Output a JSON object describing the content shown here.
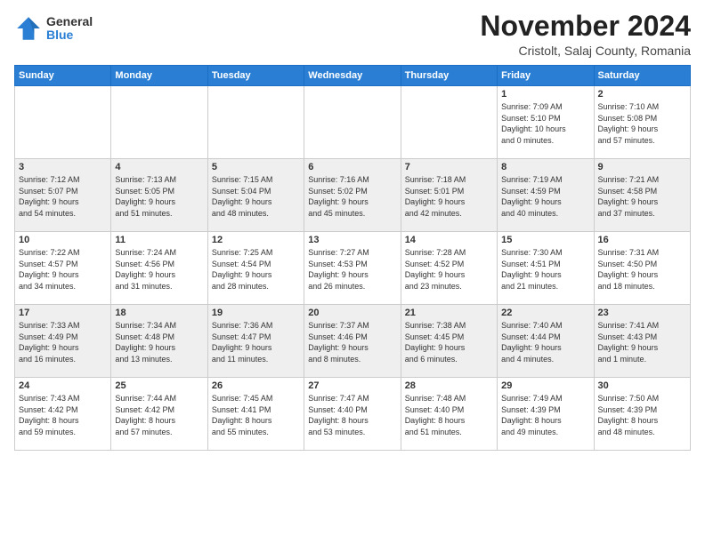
{
  "logo": {
    "general": "General",
    "blue": "Blue"
  },
  "title": "November 2024",
  "location": "Cristolt, Salaj County, Romania",
  "days_header": [
    "Sunday",
    "Monday",
    "Tuesday",
    "Wednesday",
    "Thursday",
    "Friday",
    "Saturday"
  ],
  "weeks": [
    [
      {
        "day": "",
        "info": ""
      },
      {
        "day": "",
        "info": ""
      },
      {
        "day": "",
        "info": ""
      },
      {
        "day": "",
        "info": ""
      },
      {
        "day": "",
        "info": ""
      },
      {
        "day": "1",
        "info": "Sunrise: 7:09 AM\nSunset: 5:10 PM\nDaylight: 10 hours\nand 0 minutes."
      },
      {
        "day": "2",
        "info": "Sunrise: 7:10 AM\nSunset: 5:08 PM\nDaylight: 9 hours\nand 57 minutes."
      }
    ],
    [
      {
        "day": "3",
        "info": "Sunrise: 7:12 AM\nSunset: 5:07 PM\nDaylight: 9 hours\nand 54 minutes."
      },
      {
        "day": "4",
        "info": "Sunrise: 7:13 AM\nSunset: 5:05 PM\nDaylight: 9 hours\nand 51 minutes."
      },
      {
        "day": "5",
        "info": "Sunrise: 7:15 AM\nSunset: 5:04 PM\nDaylight: 9 hours\nand 48 minutes."
      },
      {
        "day": "6",
        "info": "Sunrise: 7:16 AM\nSunset: 5:02 PM\nDaylight: 9 hours\nand 45 minutes."
      },
      {
        "day": "7",
        "info": "Sunrise: 7:18 AM\nSunset: 5:01 PM\nDaylight: 9 hours\nand 42 minutes."
      },
      {
        "day": "8",
        "info": "Sunrise: 7:19 AM\nSunset: 4:59 PM\nDaylight: 9 hours\nand 40 minutes."
      },
      {
        "day": "9",
        "info": "Sunrise: 7:21 AM\nSunset: 4:58 PM\nDaylight: 9 hours\nand 37 minutes."
      }
    ],
    [
      {
        "day": "10",
        "info": "Sunrise: 7:22 AM\nSunset: 4:57 PM\nDaylight: 9 hours\nand 34 minutes."
      },
      {
        "day": "11",
        "info": "Sunrise: 7:24 AM\nSunset: 4:56 PM\nDaylight: 9 hours\nand 31 minutes."
      },
      {
        "day": "12",
        "info": "Sunrise: 7:25 AM\nSunset: 4:54 PM\nDaylight: 9 hours\nand 28 minutes."
      },
      {
        "day": "13",
        "info": "Sunrise: 7:27 AM\nSunset: 4:53 PM\nDaylight: 9 hours\nand 26 minutes."
      },
      {
        "day": "14",
        "info": "Sunrise: 7:28 AM\nSunset: 4:52 PM\nDaylight: 9 hours\nand 23 minutes."
      },
      {
        "day": "15",
        "info": "Sunrise: 7:30 AM\nSunset: 4:51 PM\nDaylight: 9 hours\nand 21 minutes."
      },
      {
        "day": "16",
        "info": "Sunrise: 7:31 AM\nSunset: 4:50 PM\nDaylight: 9 hours\nand 18 minutes."
      }
    ],
    [
      {
        "day": "17",
        "info": "Sunrise: 7:33 AM\nSunset: 4:49 PM\nDaylight: 9 hours\nand 16 minutes."
      },
      {
        "day": "18",
        "info": "Sunrise: 7:34 AM\nSunset: 4:48 PM\nDaylight: 9 hours\nand 13 minutes."
      },
      {
        "day": "19",
        "info": "Sunrise: 7:36 AM\nSunset: 4:47 PM\nDaylight: 9 hours\nand 11 minutes."
      },
      {
        "day": "20",
        "info": "Sunrise: 7:37 AM\nSunset: 4:46 PM\nDaylight: 9 hours\nand 8 minutes."
      },
      {
        "day": "21",
        "info": "Sunrise: 7:38 AM\nSunset: 4:45 PM\nDaylight: 9 hours\nand 6 minutes."
      },
      {
        "day": "22",
        "info": "Sunrise: 7:40 AM\nSunset: 4:44 PM\nDaylight: 9 hours\nand 4 minutes."
      },
      {
        "day": "23",
        "info": "Sunrise: 7:41 AM\nSunset: 4:43 PM\nDaylight: 9 hours\nand 1 minute."
      }
    ],
    [
      {
        "day": "24",
        "info": "Sunrise: 7:43 AM\nSunset: 4:42 PM\nDaylight: 8 hours\nand 59 minutes."
      },
      {
        "day": "25",
        "info": "Sunrise: 7:44 AM\nSunset: 4:42 PM\nDaylight: 8 hours\nand 57 minutes."
      },
      {
        "day": "26",
        "info": "Sunrise: 7:45 AM\nSunset: 4:41 PM\nDaylight: 8 hours\nand 55 minutes."
      },
      {
        "day": "27",
        "info": "Sunrise: 7:47 AM\nSunset: 4:40 PM\nDaylight: 8 hours\nand 53 minutes."
      },
      {
        "day": "28",
        "info": "Sunrise: 7:48 AM\nSunset: 4:40 PM\nDaylight: 8 hours\nand 51 minutes."
      },
      {
        "day": "29",
        "info": "Sunrise: 7:49 AM\nSunset: 4:39 PM\nDaylight: 8 hours\nand 49 minutes."
      },
      {
        "day": "30",
        "info": "Sunrise: 7:50 AM\nSunset: 4:39 PM\nDaylight: 8 hours\nand 48 minutes."
      }
    ]
  ]
}
